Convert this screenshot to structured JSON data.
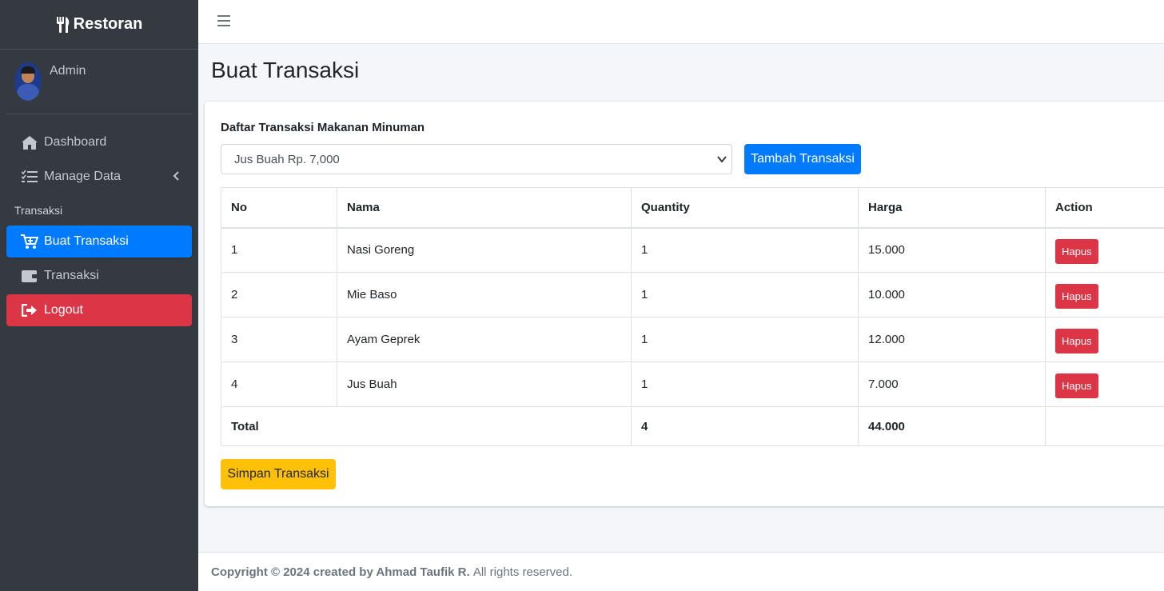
{
  "brand": {
    "name": "Restoran"
  },
  "user": {
    "name": "Admin"
  },
  "sidebar": {
    "items": [
      {
        "label": "Dashboard",
        "icon": "home-icon"
      },
      {
        "label": "Manage Data",
        "icon": "list-check-icon"
      }
    ],
    "header": "Transaksi",
    "items2": [
      {
        "label": "Buat Transaksi",
        "icon": "cart-plus-icon",
        "active": true
      },
      {
        "label": "Transaksi",
        "icon": "wallet-icon"
      },
      {
        "label": "Logout",
        "icon": "sign-out-icon"
      }
    ]
  },
  "page": {
    "title": "Buat Transaksi"
  },
  "form": {
    "label": "Daftar Transaksi Makanan Minuman",
    "selected": "Jus Buah Rp. 7,000",
    "add_button": "Tambah Transaksi",
    "save_button": "Simpan Transaksi"
  },
  "table": {
    "headers": [
      "No",
      "Nama",
      "Quantity",
      "Harga",
      "Action"
    ],
    "rows": [
      {
        "no": "1",
        "nama": "Nasi Goreng",
        "qty": "1",
        "harga": "15.000",
        "action": "Hapus"
      },
      {
        "no": "2",
        "nama": "Mie Baso",
        "qty": "1",
        "harga": "10.000",
        "action": "Hapus"
      },
      {
        "no": "3",
        "nama": "Ayam Geprek",
        "qty": "1",
        "harga": "12.000",
        "action": "Hapus"
      },
      {
        "no": "4",
        "nama": "Jus Buah",
        "qty": "1",
        "harga": "7.000",
        "action": "Hapus"
      }
    ],
    "total": {
      "label": "Total",
      "qty": "4",
      "harga": "44.000"
    }
  },
  "footer": {
    "copyright": "Copyright © 2024 created by Ahmad Taufik R.",
    "rights": "All rights reserved."
  },
  "colors": {
    "sidebar_bg": "#343a40",
    "primary": "#007bff",
    "danger": "#dc3545",
    "warning": "#ffc107"
  }
}
